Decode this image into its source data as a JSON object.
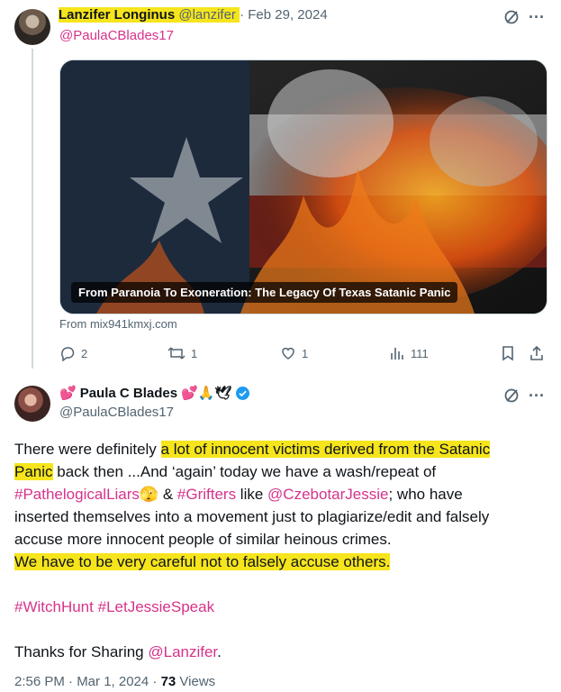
{
  "tweet1": {
    "author_name": "Lanzifer Longinus",
    "author_handle": "@lanzifer",
    "date": "· Feb 29, 2024",
    "reply_to": "@PaulaCBlades17",
    "card": {
      "caption": "From Paranoia To Exoneration: The Legacy Of Texas Satanic Panic",
      "source": "From mix941kmxj.com"
    },
    "actions": {
      "replies": "2",
      "retweets": "1",
      "likes": "1",
      "views": "111"
    }
  },
  "tweet2": {
    "author_name": "Paula C Blades",
    "author_handle": "@PaulaCBlades17",
    "name_emojis_before": "💕",
    "name_emojis_after": "💕🙏🕊",
    "body": {
      "l1a": "There were definitely ",
      "l1b": "a lot of innocent victims derived from the Satanic",
      "l2a": "Panic",
      "l2b": " back then   ...And ‘again’ today we have a wash/repeat of",
      "l3a": "#PathelogicalLiars",
      "l3emoji": "🫣",
      "l3b": " & ",
      "l3c": "#Grifters",
      "l3d": " like  ",
      "l3e": "@CzebotarJessie",
      "l3f": "; who have",
      "l4": "inserted themselves into a movement just to plagiarize/edit and falsely",
      "l5": "accuse more innocent people of similar heinous crimes.",
      "l6": "We have to be very careful not to falsely accuse others",
      "l6end": ".",
      "tags1": "#WitchHunt",
      "tags2": "#LetJessieSpeak",
      "thanks": "Thanks for Sharing  ",
      "thanks_mention": "@Lanzifer",
      "thanks_end": "."
    },
    "meta_time": "2:56 PM · Mar 1, 2024 · ",
    "meta_views_count": "73",
    "meta_views_label": " Views"
  },
  "colors": {
    "link": "#d6338a",
    "highlight": "#f6e51c",
    "muted": "#536471",
    "verified": "#1d9bf0"
  }
}
